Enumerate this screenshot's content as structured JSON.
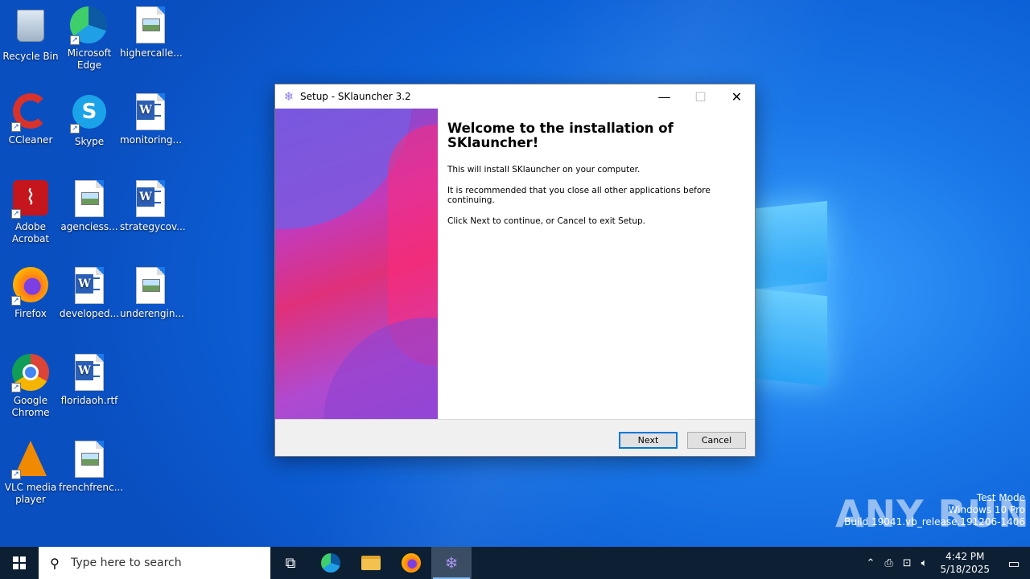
{
  "desktop": {
    "icons": [
      {
        "label": "Recycle Bin"
      },
      {
        "label": "Microsoft Edge"
      },
      {
        "label": "highercalle..."
      },
      {
        "label": "CCleaner"
      },
      {
        "label": "Skype"
      },
      {
        "label": "monitoring..."
      },
      {
        "label": "Adobe Acrobat"
      },
      {
        "label": "agenciess..."
      },
      {
        "label": "strategycov..."
      },
      {
        "label": "Firefox"
      },
      {
        "label": "developed..."
      },
      {
        "label": "underengin..."
      },
      {
        "label": "Google Chrome"
      },
      {
        "label": "floridaoh.rtf"
      },
      {
        "label": "VLC media player"
      },
      {
        "label": "frenchfrenc..."
      }
    ]
  },
  "window": {
    "title": "Setup - SKlauncher 3.2",
    "heading": "Welcome to the installation of SKlauncher!",
    "para1": "This will install SKlauncher on your computer.",
    "para2": "It is recommended that you close all other applications before continuing.",
    "para3": "Click Next to continue, or Cancel to exit Setup.",
    "next_label": "Next",
    "cancel_label": "Cancel",
    "minimize_glyph": "—",
    "maximize_glyph": "☐",
    "close_glyph": "✕"
  },
  "watermark": {
    "brand": "ANY RUN",
    "line1": "Test Mode",
    "line2": "Windows 10 Pro",
    "line3": "Build 19041.vb_release.191206-1406"
  },
  "taskbar": {
    "search_placeholder": "Type here to search",
    "time": "4:42 PM",
    "date": "5/18/2025"
  },
  "colors": {
    "accent": "#0078d7",
    "taskbar": "#0d1f33"
  }
}
